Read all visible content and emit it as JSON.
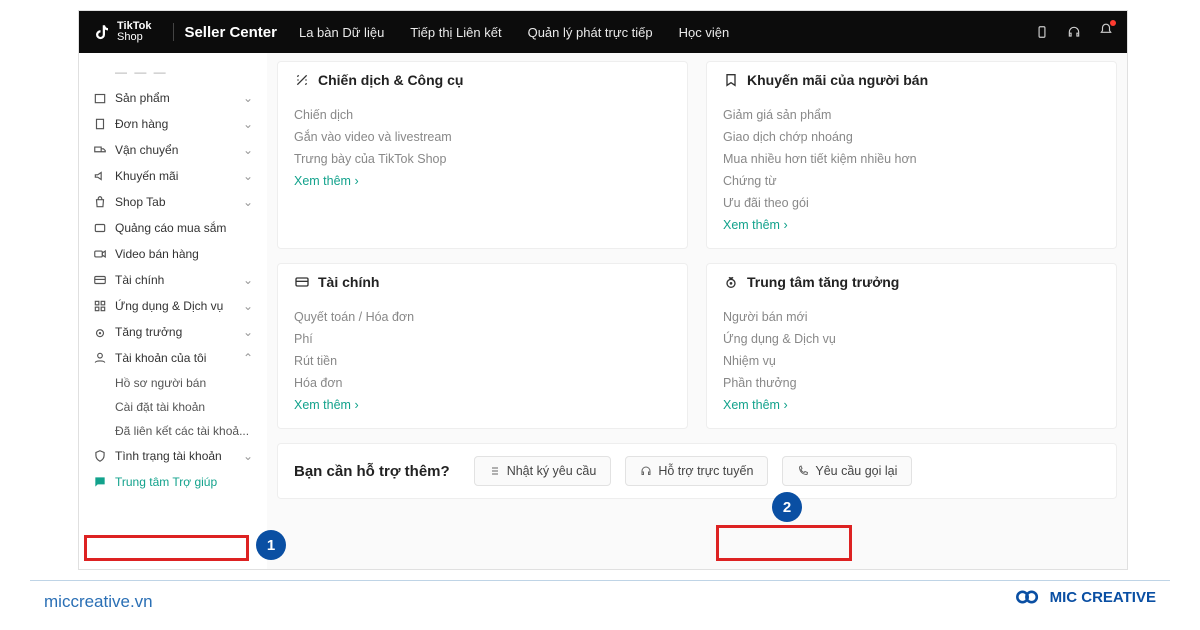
{
  "brand": {
    "name": "TikTok",
    "sub": "Shop"
  },
  "app_title": "Seller Center",
  "topnav": [
    "La bàn Dữ liệu",
    "Tiếp thị Liên kết",
    "Quản lý phát trực tiếp",
    "Học viện"
  ],
  "sidebar": {
    "items": [
      {
        "label": "— — —",
        "chevron": "",
        "trunc": true,
        "icon": "dots"
      },
      {
        "label": "Sản phẩm",
        "chevron": "⌄",
        "icon": "box"
      },
      {
        "label": "Đơn hàng",
        "chevron": "⌄",
        "icon": "doc"
      },
      {
        "label": "Vận chuyển",
        "chevron": "⌄",
        "icon": "truck"
      },
      {
        "label": "Khuyến mãi",
        "chevron": "⌄",
        "icon": "speaker"
      },
      {
        "label": "Shop Tab",
        "chevron": "⌄",
        "icon": "bag"
      },
      {
        "label": "Quảng cáo mua sắm",
        "chevron": "",
        "icon": "ad"
      },
      {
        "label": "Video bán hàng",
        "chevron": "",
        "icon": "video"
      },
      {
        "label": "Tài chính",
        "chevron": "⌄",
        "icon": "card"
      },
      {
        "label": "Ứng dụng & Dịch vụ",
        "chevron": "⌄",
        "icon": "grid"
      },
      {
        "label": "Tăng trưởng",
        "chevron": "⌄",
        "icon": "target"
      },
      {
        "label": "Tài khoản của tôi",
        "chevron": "⌃",
        "icon": "user"
      }
    ],
    "subs": [
      "Hồ sơ người bán",
      "Cài đặt tài khoản",
      "Đã liên kết các tài khoả..."
    ],
    "status": {
      "label": "Tình trạng tài khoản",
      "chevron": "⌄"
    },
    "help": {
      "label": "Trung tâm Trợ giúp"
    }
  },
  "cards": {
    "r1c1": {
      "title": "Chiến dịch & Công cụ",
      "items": [
        "Chiến dịch",
        "Gắn vào video và livestream",
        "Trưng bày của TikTok Shop"
      ],
      "more": "Xem thêm"
    },
    "r1c2": {
      "title": "Khuyến mãi của người bán",
      "items": [
        "Giảm giá sản phẩm",
        "Giao dịch chớp nhoáng",
        "Mua nhiều hơn tiết kiệm nhiều hơn",
        "Chứng từ",
        "Ưu đãi theo gói"
      ],
      "more": "Xem thêm"
    },
    "r2c1": {
      "title": "Tài chính",
      "items": [
        "Quyết toán / Hóa đơn",
        "Phí",
        "Rút tiền",
        "Hóa đơn"
      ],
      "more": "Xem thêm"
    },
    "r2c2": {
      "title": "Trung tâm tăng trưởng",
      "items": [
        "Người bán mới",
        "Ứng dụng & Dịch vụ",
        "Nhiệm vụ",
        "Phần thưởng"
      ],
      "more": "Xem thêm"
    }
  },
  "support": {
    "title": "Bạn cần hỗ trợ thêm?",
    "chips": [
      "Nhật ký yêu cầu",
      "Hỗ trợ trực tuyến",
      "Yêu cầu gọi lại"
    ]
  },
  "annotations": {
    "1": "1",
    "2": "2"
  },
  "footer": {
    "url": "miccreative.vn",
    "brand": "MIC CREATIVE"
  }
}
